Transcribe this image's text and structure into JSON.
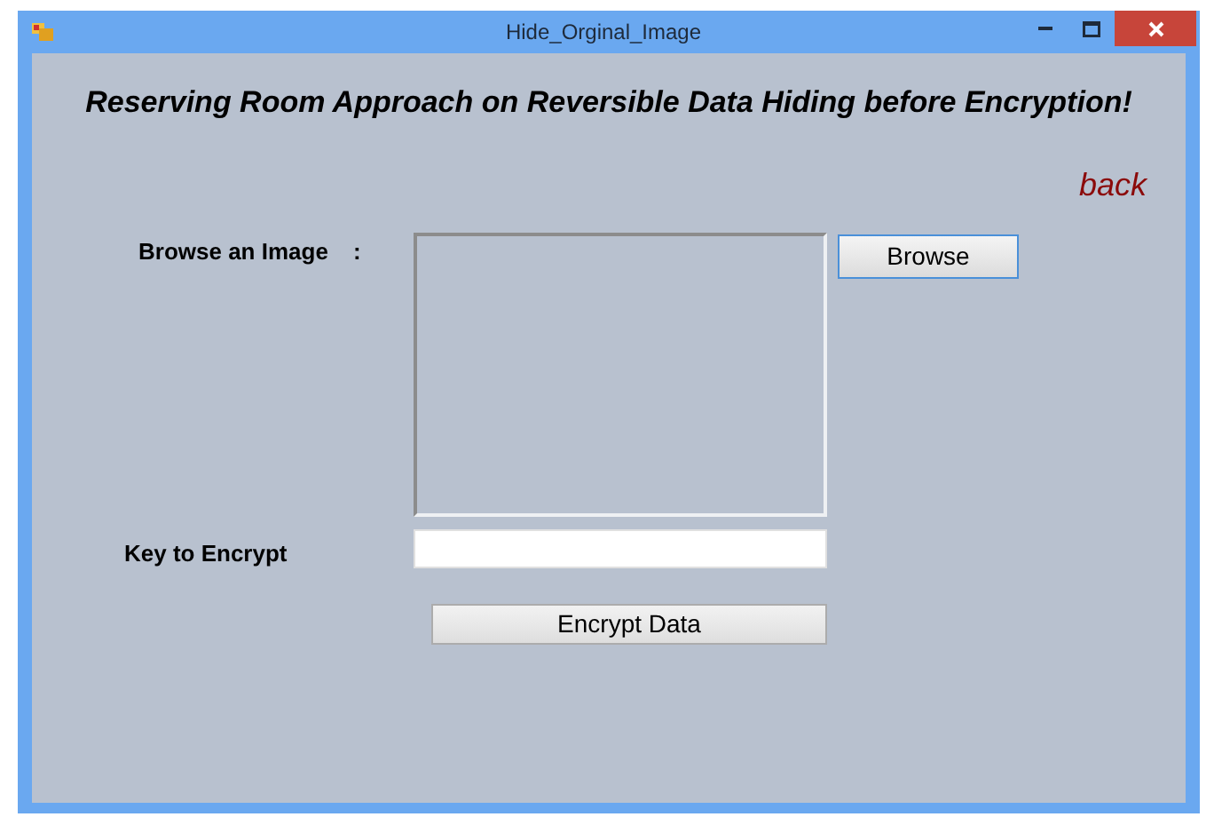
{
  "window": {
    "title": "Hide_Orginal_Image"
  },
  "heading": "Reserving Room Approach on Reversible Data Hiding before Encryption!",
  "back_link": "back",
  "browse_label": "Browse an Image",
  "browse_colon": ":",
  "browse_button": "Browse",
  "key_label": "Key to Encrypt",
  "encrypt_button": "Encrypt Data"
}
